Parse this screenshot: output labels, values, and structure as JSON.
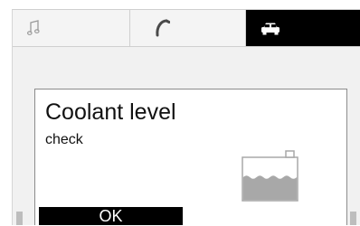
{
  "tabs": [
    {
      "icon": "music-note-icon",
      "active": false
    },
    {
      "icon": "phone-icon",
      "active": false
    },
    {
      "icon": "car-icon",
      "active": true
    }
  ],
  "dialog": {
    "title": "Coolant level",
    "message": "check",
    "icon": "coolant-reservoir-icon",
    "ok_label": "OK"
  },
  "colors": {
    "screen_background": "#f1f1f1",
    "active_tab": "#000000",
    "coolant_fill": "#a8a8a8"
  }
}
